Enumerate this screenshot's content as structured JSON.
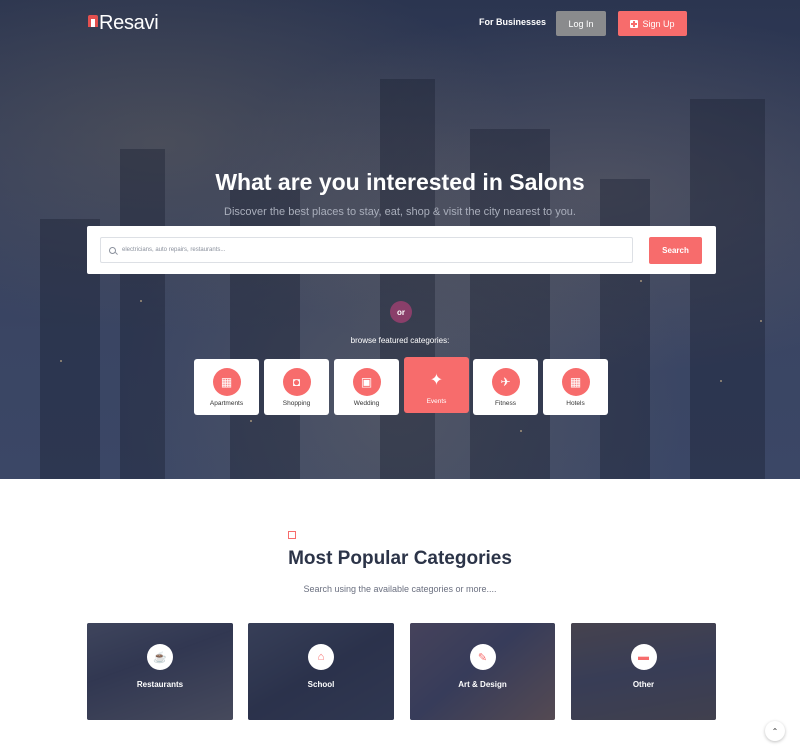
{
  "header": {
    "logo_text": "Resavi",
    "for_businesses": "For Businesses",
    "login_label": "Log In",
    "signup_label": "Sign Up"
  },
  "hero": {
    "title": "What are you interested in Salons",
    "subtitle": "Discover the best places to stay, eat, shop & visit the city nearest to you.",
    "search_placeholder": "electricians, auto repairs, restaurants...",
    "search_button": "Search",
    "or_label": "or",
    "browse_label": "browse featured categories:"
  },
  "featured_categories": [
    {
      "label": "Apartments",
      "icon": "building-icon",
      "glyph": "▦",
      "active": false
    },
    {
      "label": "Shopping",
      "icon": "shopping-bag-icon",
      "glyph": "◘",
      "active": false
    },
    {
      "label": "Wedding",
      "icon": "calendar-heart-icon",
      "glyph": "▣",
      "active": false
    },
    {
      "label": "Events",
      "icon": "maple-leaf-icon",
      "glyph": "✦",
      "active": true
    },
    {
      "label": "Fitness",
      "icon": "runner-icon",
      "glyph": "✈",
      "active": false
    },
    {
      "label": "Hotels",
      "icon": "hotel-icon",
      "glyph": "▦",
      "active": false
    }
  ],
  "popular": {
    "title": "Most Popular Categories",
    "subtitle": "Search using the available categories or more....",
    "cards": [
      {
        "label": "Restaurants",
        "icon": "coffee-cup-icon",
        "glyph": "☕"
      },
      {
        "label": "School",
        "icon": "school-icon",
        "glyph": "⌂"
      },
      {
        "label": "Art & Design",
        "icon": "brush-icon",
        "glyph": "✎"
      },
      {
        "label": "Other",
        "icon": "truck-icon",
        "glyph": "▬"
      }
    ]
  },
  "colors": {
    "accent": "#f76c6c",
    "hero_overlay": "#323d5c",
    "or_badge": "#8a3f6a",
    "login_button": "#8a8b8d"
  }
}
